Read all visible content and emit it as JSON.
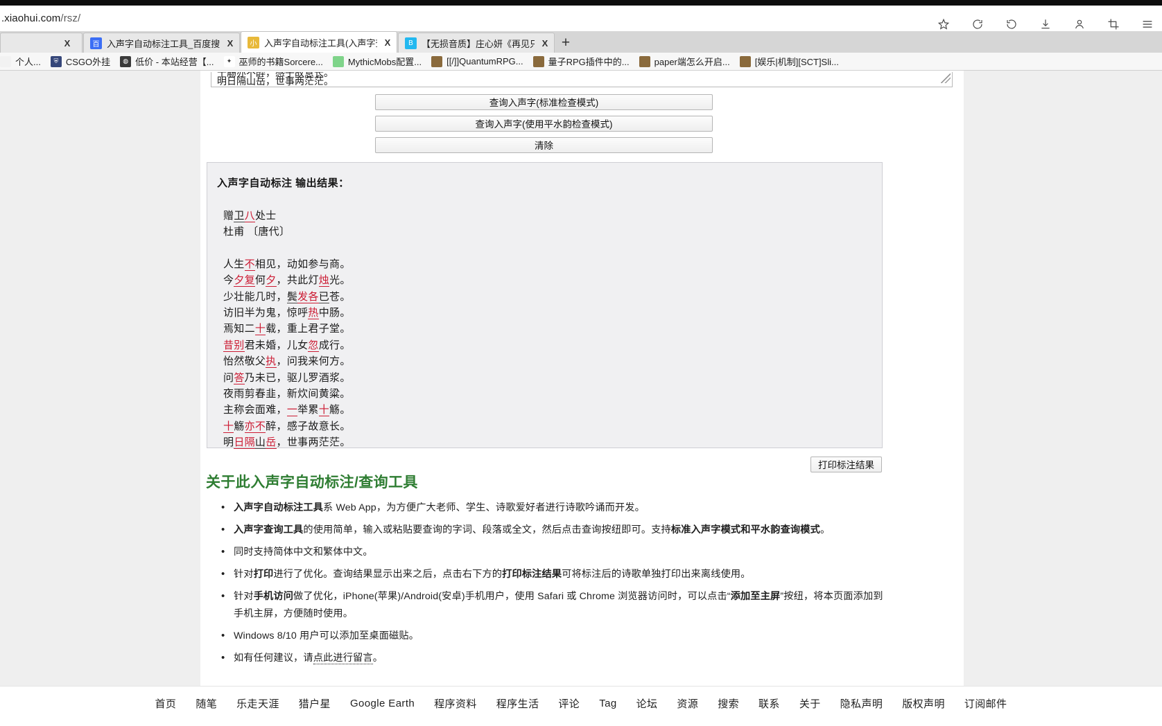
{
  "browser": {
    "url_prefix": ".xiaohui.com",
    "url_suffix": "/rsz/",
    "toolbar_icons": [
      "bookmark-star-icon",
      "sync-icon",
      "history-icon",
      "download-icon",
      "profile-icon",
      "screenshot-crop-icon",
      "menu-icon"
    ],
    "tabs": [
      {
        "title": "",
        "favicon": "",
        "favicon_color": "#cfcfcf",
        "close": "X",
        "active": false
      },
      {
        "title": "入声字自动标注工具_百度搜索",
        "favicon": "百",
        "favicon_color": "#3b6ef5",
        "close": "X",
        "active": false
      },
      {
        "title": "入声字自动标注工具(入声字查",
        "favicon": "小",
        "favicon_color": "#e8b93a",
        "close": "X",
        "active": true
      },
      {
        "title": "【无损音质】庄心妍《再见只是",
        "favicon": "B",
        "favicon_color": "#22b8f0",
        "close": "X",
        "active": false
      }
    ],
    "newtab_label": "+",
    "bookmarks": [
      {
        "label": "个人...",
        "icon": "",
        "icon_color": "#f2f2f2"
      },
      {
        "label": "CSGO外挂",
        "icon": "",
        "icon_color": "#36477a"
      },
      {
        "label": "低价 - 本站经营【...",
        "icon": "",
        "icon_color": "#3a3a3a"
      },
      {
        "label": "巫师的书籍Sorcere...",
        "icon": "",
        "icon_color": "#ffffff"
      },
      {
        "label": "MythicMobs配置...",
        "icon": "",
        "icon_color": "#7fd48a"
      },
      {
        "label": "[[/]]QuantumRPG...",
        "icon": "",
        "icon_color": "#8a6a3c"
      },
      {
        "label": "量子RPG插件中的...",
        "icon": "",
        "icon_color": "#8a6a3c"
      },
      {
        "label": "paper端怎么开启...",
        "icon": "",
        "icon_color": "#8a6a3c"
      },
      {
        "label": "[娱乐|机制][SCT]Sli...",
        "icon": "",
        "icon_color": "#8a6a3c"
      }
    ]
  },
  "textarea_remnant": {
    "line1": "十觞亦不醉，感子故意长。",
    "line2": "明日隔山岳，世事两茫茫。"
  },
  "buttons": {
    "query_standard": "查询入声字(标准检查模式)",
    "query_pingshui": "查询入声字(使用平水韵检查模式)",
    "clear": "清除",
    "print_result": "打印标注结果"
  },
  "result": {
    "heading": "入声字自动标注 输出结果：",
    "poem_title_parts": [
      {
        "t": "赠",
        "m": "none"
      },
      {
        "t": "卫",
        "m": "black"
      },
      {
        "t": "八",
        "m": "red"
      },
      {
        "t": "处士",
        "m": "none"
      }
    ],
    "poem_author": "杜甫 〔唐代〕",
    "poem_lines": [
      [
        {
          "t": "人生",
          "m": "none"
        },
        {
          "t": "不",
          "m": "red"
        },
        {
          "t": "相见，动如参与商。",
          "m": "none"
        }
      ],
      [
        {
          "t": "今",
          "m": "none"
        },
        {
          "t": "夕复",
          "m": "red"
        },
        {
          "t": "何",
          "m": "none"
        },
        {
          "t": "夕",
          "m": "red"
        },
        {
          "t": "，共此灯",
          "m": "none"
        },
        {
          "t": "烛",
          "m": "red"
        },
        {
          "t": "光。",
          "m": "none"
        }
      ],
      [
        {
          "t": "少壮能几时，",
          "m": "none"
        },
        {
          "t": "鬓",
          "m": "black"
        },
        {
          "t": "发各",
          "m": "red"
        },
        {
          "t": "已",
          "m": "black"
        },
        {
          "t": "苍。",
          "m": "none"
        }
      ],
      [
        {
          "t": "访旧半为鬼，惊呼",
          "m": "none"
        },
        {
          "t": "热",
          "m": "red"
        },
        {
          "t": "中肠。",
          "m": "none"
        }
      ],
      [
        {
          "t": "焉知二",
          "m": "none"
        },
        {
          "t": "十",
          "m": "red"
        },
        {
          "t": "载，重上君子堂。",
          "m": "none"
        }
      ],
      [
        {
          "t": "昔别",
          "m": "red"
        },
        {
          "t": "君未婚，儿女",
          "m": "none"
        },
        {
          "t": "忽",
          "m": "red"
        },
        {
          "t": "成行。",
          "m": "none"
        }
      ],
      [
        {
          "t": "怡然敬父",
          "m": "none"
        },
        {
          "t": "执",
          "m": "red"
        },
        {
          "t": "，问我来何方。",
          "m": "none"
        }
      ],
      [
        {
          "t": "问",
          "m": "none"
        },
        {
          "t": "答",
          "m": "red"
        },
        {
          "t": "乃未已，驱儿罗酒浆。",
          "m": "none"
        }
      ],
      [
        {
          "t": "夜雨剪春韭，新炊间黄粱。",
          "m": "none"
        }
      ],
      [
        {
          "t": "主称会面难，",
          "m": "none"
        },
        {
          "t": "一",
          "m": "red"
        },
        {
          "t": "举累",
          "m": "none"
        },
        {
          "t": "十",
          "m": "red"
        },
        {
          "t": "觞。",
          "m": "none"
        }
      ],
      [
        {
          "t": "十",
          "m": "red"
        },
        {
          "t": "觞",
          "m": "none"
        },
        {
          "t": "亦不",
          "m": "red"
        },
        {
          "t": "醉，感子故意长。",
          "m": "none"
        }
      ],
      [
        {
          "t": "明",
          "m": "none"
        },
        {
          "t": "日隔",
          "m": "red"
        },
        {
          "t": "山",
          "m": "black"
        },
        {
          "t": "岳",
          "m": "red"
        },
        {
          "t": "，世事两茫茫。",
          "m": "none"
        }
      ]
    ]
  },
  "about": {
    "title": "关于此入声字自动标注/查询工具",
    "items": [
      "入声字自动标注工具系 Web App，为方便广大老师、学生、诗歌爱好者进行诗歌吟诵而开发。",
      "入声字查询工具的使用简单，输入或粘贴要查询的字词、段落或全文，然后点击查询按纽即可。支持标准入声字模式和平水韵查询模式。",
      "同时支持简体中文和繁体中文。",
      "针对打印进行了优化。查询结果显示出来之后，点击右下方的打印标注结果可将标注后的诗歌单独打印出来离线使用。",
      "针对手机访问做了优化，iPhone(苹果)/Android(安卓)手机用户，使用 Safari 或 Chrome 浏览器访问时，可以点击“添加至主屏”按纽，将本页面添加到手机主屏，方便随时使用。",
      "Windows 8/10 用户可以添加至桌面磁贴。",
      "如有任何建议，请点此进行留言。"
    ]
  },
  "footer": {
    "links": [
      "首页",
      "随笔",
      "乐走天涯",
      "猎户星",
      "Google Earth",
      "程序资料",
      "程序生活",
      "评论",
      "Tag",
      "论坛",
      "资源",
      "搜索",
      "联系",
      "关于",
      "隐私声明",
      "版权声明",
      "订阅邮件"
    ]
  },
  "colors": {
    "entering_tone_red": "#cc1b33",
    "heading_green": "#2e7d32",
    "panel_bg": "#f0f0f2"
  }
}
